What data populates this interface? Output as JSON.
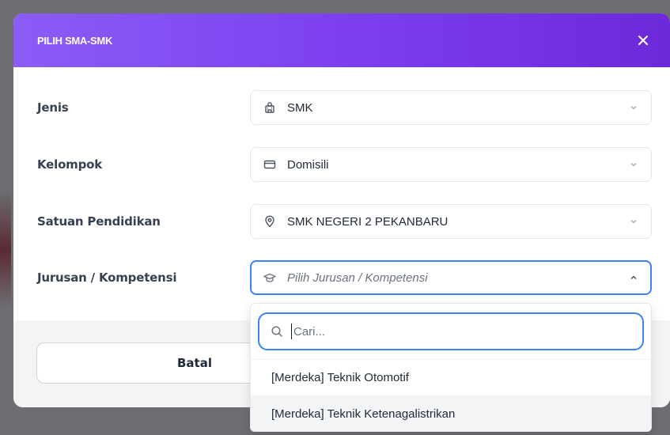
{
  "modal": {
    "title": "PILIH SMA-SMK"
  },
  "form": {
    "jenis": {
      "label": "Jenis",
      "value": "SMK",
      "icon": "building-icon"
    },
    "kelompok": {
      "label": "Kelompok",
      "value": "Domisili",
      "icon": "card-icon"
    },
    "satuan": {
      "label": "Satuan Pendidikan",
      "value": "SMK NEGERI 2 PEKANBARU",
      "icon": "location-pin-icon"
    },
    "jurusan": {
      "label": "Jurusan / Kompetensi",
      "placeholder": "Pilih Jurusan / Kompetensi",
      "icon": "graduation-cap-icon"
    }
  },
  "footer": {
    "cancel_label": "Batal"
  },
  "dropdown": {
    "search_placeholder": "Cari...",
    "options": [
      "[Merdeka] Teknik Otomotif",
      "[Merdeka] Teknik Ketenagalistrikan"
    ]
  },
  "colors": {
    "header_gradient_start": "#8b5cf6",
    "header_gradient_end": "#6d28d9",
    "focus_border": "#3b82f6"
  }
}
